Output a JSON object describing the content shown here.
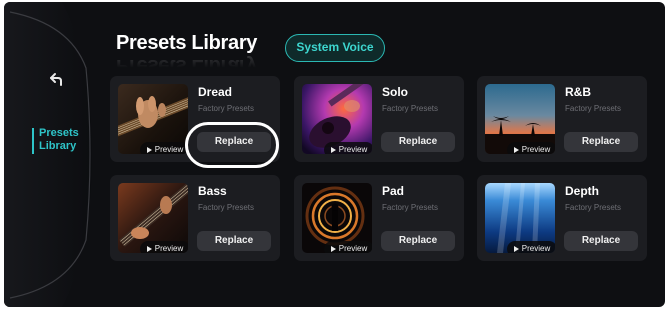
{
  "sidebar": {
    "back_icon": "back-arrow-icon",
    "active_item": {
      "line1": "Presets",
      "line2": "Library"
    }
  },
  "header": {
    "title": "Presets Library",
    "system_voice_label": "System Voice"
  },
  "presets": [
    {
      "name": "Dread",
      "subtitle": "Factory Presets",
      "preview_label": "Preview",
      "replace_label": "Replace",
      "art": "guitar-hand-warm"
    },
    {
      "name": "Solo",
      "subtitle": "Factory Presets",
      "preview_label": "Preview",
      "replace_label": "Replace",
      "art": "guitar-neon-purple"
    },
    {
      "name": "R&B",
      "subtitle": "Factory Presets",
      "preview_label": "Preview",
      "replace_label": "Replace",
      "art": "palm-sunset"
    },
    {
      "name": "Bass",
      "subtitle": "Factory Presets",
      "preview_label": "Preview",
      "replace_label": "Replace",
      "art": "bass-guitar-dark"
    },
    {
      "name": "Pad",
      "subtitle": "Factory Presets",
      "preview_label": "Preview",
      "replace_label": "Replace",
      "art": "light-tunnel"
    },
    {
      "name": "Depth",
      "subtitle": "Factory Presets",
      "preview_label": "Preview",
      "replace_label": "Replace",
      "art": "underwater-blue"
    }
  ],
  "colors": {
    "accent": "#2ec4c8",
    "background": "#0e0f12",
    "card": "#1c1d21",
    "button": "#34353a"
  }
}
